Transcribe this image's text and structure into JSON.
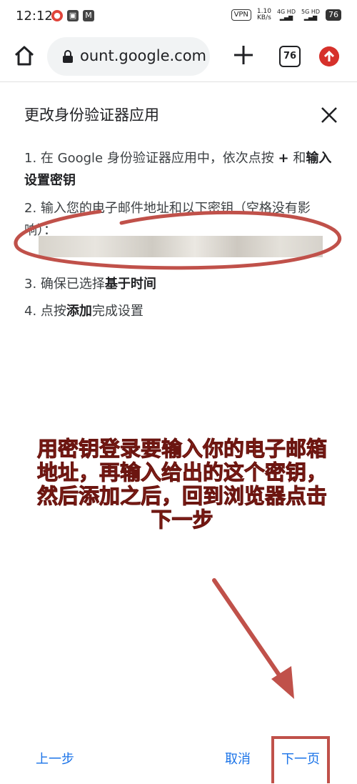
{
  "status_bar": {
    "time": "12:12",
    "vpn": "VPN",
    "speed_value": "1.10",
    "speed_unit": "KB/s",
    "signal_1": "4G HD",
    "signal_2": "5G HD",
    "battery": "76"
  },
  "browser": {
    "url": "ount.google.com",
    "tab_count": "76"
  },
  "dialog": {
    "title": "更改身份验证器应用",
    "step1_prefix": "1. 在 Google 身份验证器应用中，依次点按 ",
    "step1_plus": "+",
    "step1_mid": " 和",
    "step1_bold": "输入设置密钥",
    "step2": "2. 输入您的电子邮件地址和以下密钥（空格没有影响）：",
    "step3_prefix": "3. 确保已选择",
    "step3_bold": "基于时间",
    "step4_prefix": "4. 点按",
    "step4_bold": "添加",
    "step4_suffix": "完成设置"
  },
  "annotation": {
    "text": "用密钥登录要输入你的电子邮箱地址，再输入给出的这个密钥，然后添加之后，回到浏览器点击下一步",
    "color": "#c0392b"
  },
  "footer": {
    "prev_label": "上一步",
    "cancel_label": "取消",
    "next_label": "下一页"
  },
  "colors": {
    "accent": "#1a73e8",
    "annotation_red": "#c0514a"
  }
}
